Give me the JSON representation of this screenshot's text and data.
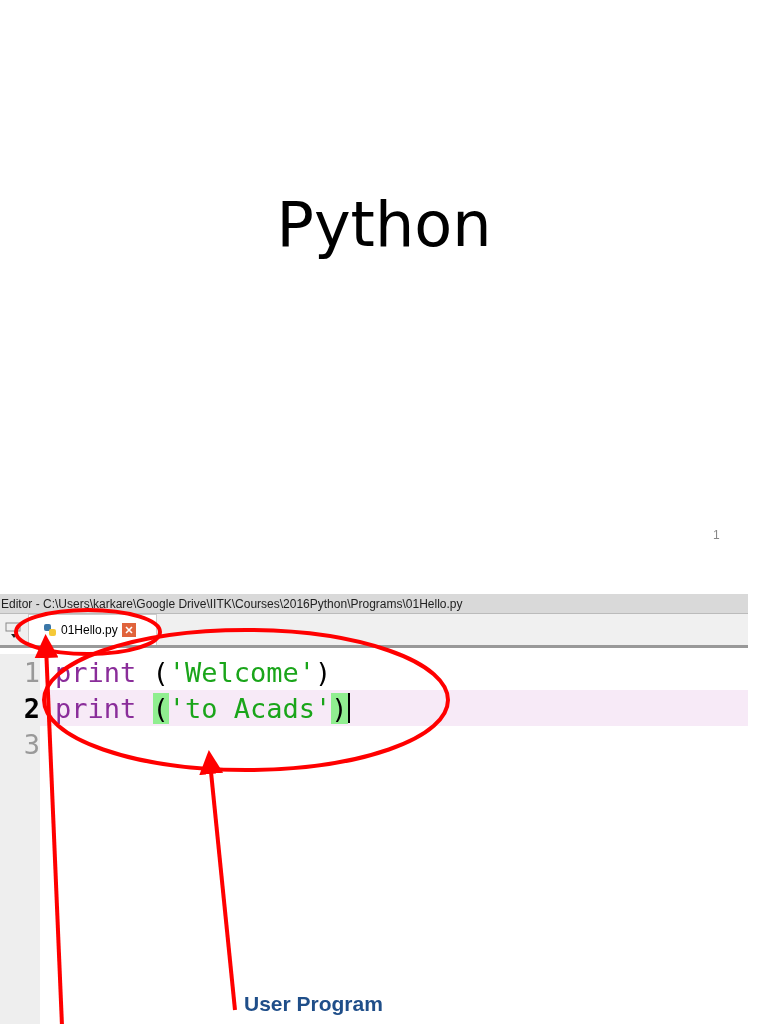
{
  "slide": {
    "title": "Python",
    "page_number": "1"
  },
  "editor": {
    "title": "Editor - C:\\Users\\karkare\\Google Drive\\IITK\\Courses\\2016Python\\Programs\\01Hello.py",
    "tabs": [
      {
        "label": "01Hello.py",
        "selected": true
      }
    ],
    "lines": [
      {
        "number": "1",
        "current": false,
        "tokens": [
          {
            "text": "print",
            "kind": "keyword"
          },
          {
            "text": "(",
            "kind": "plain"
          },
          {
            "text": "'Welcome'",
            "kind": "string"
          },
          {
            "text": ")",
            "kind": "plain"
          }
        ]
      },
      {
        "number": "2",
        "current": true,
        "tokens": [
          {
            "text": "print",
            "kind": "keyword"
          },
          {
            "text": "(",
            "kind": "match"
          },
          {
            "text": "'to Acads'",
            "kind": "string"
          },
          {
            "text": ")",
            "kind": "match"
          }
        ]
      },
      {
        "number": "3",
        "current": false
      }
    ]
  },
  "annotation": {
    "label": "User Program"
  }
}
